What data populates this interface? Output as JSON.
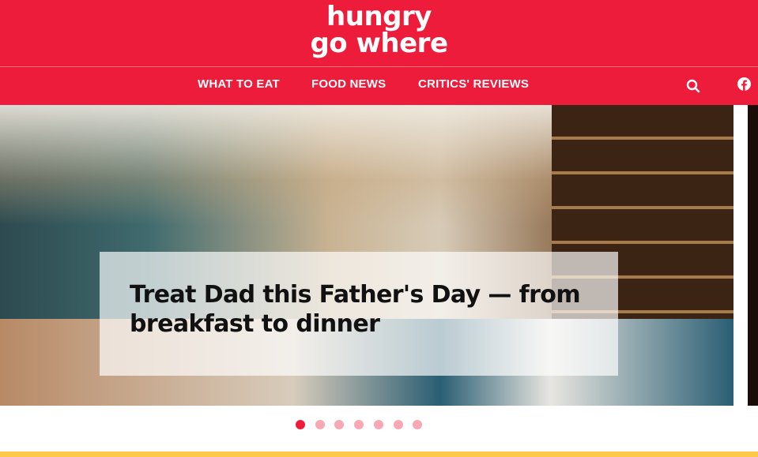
{
  "header": {
    "logo_line1": "hungry",
    "logo_line2": "go where",
    "brand_color": "#ee1c3b"
  },
  "nav": {
    "items": [
      {
        "label": "WHAT TO EAT"
      },
      {
        "label": "FOOD NEWS"
      },
      {
        "label": "CRITICS' REVIEWS"
      }
    ],
    "search_icon": "search-icon",
    "social_icon": "facebook-icon"
  },
  "hero": {
    "title": "Treat Dad this Father's Day — from breakfast to dinner"
  },
  "carousel": {
    "slide_count": 7,
    "active_index": 0,
    "active_color": "#ee1c3b",
    "inactive_color": "#f8a7b4"
  }
}
